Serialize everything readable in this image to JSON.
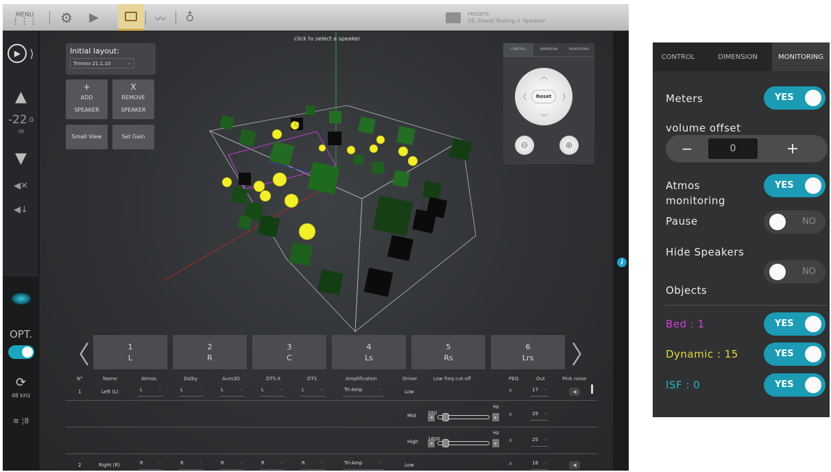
{
  "topbar": {
    "menu_label": "MENU",
    "presets_label": "PRESETS",
    "presets_value": "26. David Testing + Speaker"
  },
  "leftbar": {
    "volume_value": "-22",
    "volume_decimal": ".0",
    "volume_unit": "dB",
    "opt_label": "OPT.",
    "sample_rate": "48 kHz"
  },
  "viewer": {
    "hint": "click to select a speaker",
    "initial_layout_label": "Initial layout:",
    "initial_layout_value": "Trinnov 21.1.10",
    "add_symbol": "+",
    "add_label_1": "ADD",
    "add_label_2": "SPEAKER",
    "remove_symbol": "X",
    "remove_label_1": "REMOVE",
    "remove_label_2": "SPEAKER",
    "small_view_label": "Small View",
    "set_gain_label": "Set Gain"
  },
  "pad": {
    "tabs": [
      "CONTROL",
      "DIMENSION",
      "MONITORING"
    ],
    "reset_label": "Reset"
  },
  "speaker_tabs": [
    {
      "num": "1",
      "name": "L"
    },
    {
      "num": "2",
      "name": "R"
    },
    {
      "num": "3",
      "name": "C"
    },
    {
      "num": "4",
      "name": "Ls"
    },
    {
      "num": "5",
      "name": "Rs"
    },
    {
      "num": "6",
      "name": "Lrs"
    }
  ],
  "table": {
    "headers": [
      "N°",
      "Name",
      "Atmos",
      "Dolby",
      "Auro3D",
      "DTS:X",
      "DTS",
      "Amplification",
      "Driver",
      "Low freq cut-off",
      "PEQ",
      "Out",
      "Pink noise"
    ],
    "rows": [
      {
        "num": "1",
        "name": "Left (L)",
        "atmos": "L",
        "dolby": "L",
        "auro": "L",
        "dtsx": "L",
        "dts": "L",
        "amp": "Tri-Amp",
        "drivers": [
          {
            "driver": "Low",
            "freq": "",
            "out": "17"
          },
          {
            "driver": "Mid",
            "freq": "350",
            "out": "29"
          },
          {
            "driver": "High",
            "freq": "1600",
            "out": "25"
          }
        ]
      },
      {
        "num": "2",
        "name": "Right (R)",
        "atmos": "R",
        "dolby": "R",
        "auro": "R",
        "dtsx": "R",
        "dts": "R",
        "amp": "Tri-Amp",
        "drivers": [
          {
            "driver": "Low",
            "freq": "",
            "out": "18"
          }
        ]
      }
    ],
    "hz_unit": "Hz"
  },
  "monitor_panel": {
    "tabs": [
      "CONTROL",
      "DIMENSION",
      "MONITORING"
    ],
    "meters_label": "Meters",
    "meters_state": "YES",
    "volume_offset_label": "volume offset",
    "volume_offset_minus": "−",
    "volume_offset_value": "0",
    "volume_offset_plus": "+",
    "atmos_label_1": "Atmos",
    "atmos_label_2": "monitoring",
    "atmos_state": "YES",
    "pause_label": "Pause",
    "pause_state": "NO",
    "hide_label": "Hide Speakers",
    "hide_state": "NO",
    "objects_label": "Objects",
    "bed_label": "Bed : 1",
    "bed_state": "YES",
    "dynamic_label": "Dynamic : 15",
    "dynamic_state": "YES",
    "isf_label": "ISF : 0",
    "isf_state": "YES"
  },
  "colors": {
    "accent": "#1b9bb4",
    "bed": "#d23fd2",
    "dynamic": "#e6dc3c",
    "isf": "#2bb8c8",
    "speaker_green": "#1f6b1f",
    "object_yellow": "#f2f02a"
  }
}
